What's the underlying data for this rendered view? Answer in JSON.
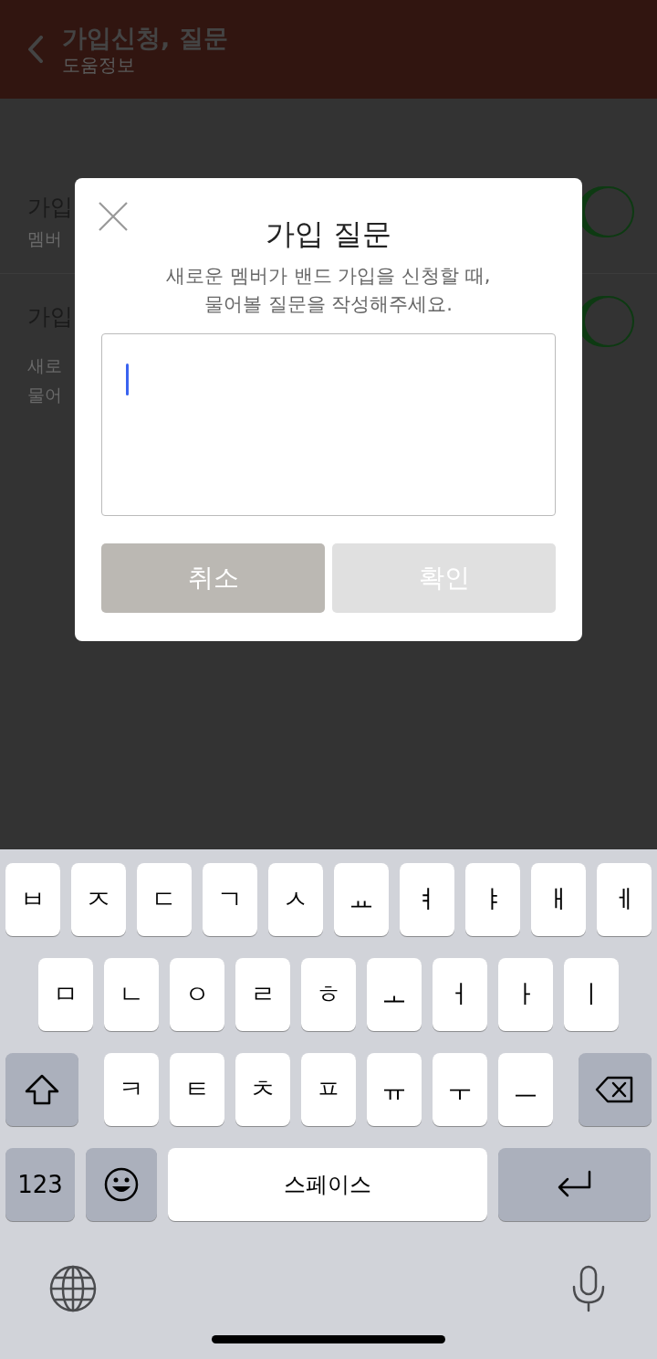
{
  "header": {
    "title": "가입신청, 질문",
    "subtitle": "도움정보"
  },
  "settings": [
    {
      "title": "가입",
      "subtitle": "멤버",
      "on": true
    },
    {
      "title": "가입",
      "description": [
        "새로",
        "물어"
      ],
      "on": true
    }
  ],
  "dialog": {
    "title": "가입 질문",
    "message": [
      "새로운 멤버가 밴드 가입을 신청할 때,",
      "물어볼 질문을 작성해주세요."
    ],
    "buttons": [
      {
        "label": "취소",
        "disabled": false
      },
      {
        "label": "확인",
        "disabled": true
      }
    ]
  },
  "keyboard": {
    "rows": [
      [
        "ㅂ",
        "ㅈ",
        "ㄷ",
        "ㄱ",
        "ㅅ",
        "ㅛ",
        "ㅕ",
        "ㅑ",
        "ㅐ",
        "ㅔ"
      ],
      [
        "ㅁ",
        "ㄴ",
        "ㅇ",
        "ㄹ",
        "ㅎ",
        "ㅗ",
        "ㅓ",
        "ㅏ",
        "ㅣ"
      ],
      [
        "ㅋ",
        "ㅌ",
        "ㅊ",
        "ㅍ",
        "ㅠ",
        "ㅜ",
        "ㅡ"
      ]
    ],
    "number_key": "123",
    "space_key": "스페이스"
  }
}
